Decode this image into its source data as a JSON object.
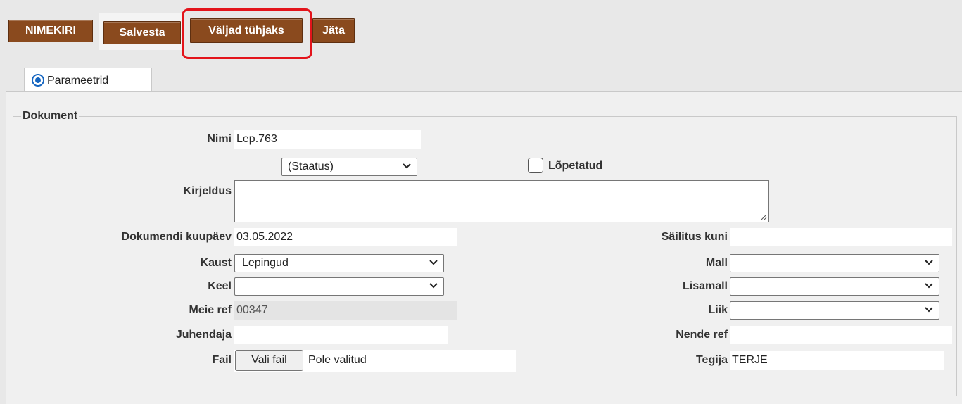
{
  "toolbar": {
    "nimekiri": "NIMEKIRI",
    "salvesta": "Salvesta",
    "valjad_tuhjaks": "Väljad tühjaks",
    "jata": "Jäta"
  },
  "tabs": [
    {
      "label": "Parameetrid",
      "selected": true
    }
  ],
  "section": {
    "legend": "Dokument"
  },
  "fields": {
    "nimi": {
      "label": "Nimi",
      "value": "Lep.763"
    },
    "staatus": {
      "value": "(Staatus)"
    },
    "lopetatud": {
      "label": "Lõpetatud",
      "checked": false
    },
    "kirjeldus": {
      "label": "Kirjeldus",
      "value": ""
    },
    "dokumendi_kuupaev": {
      "label": "Dokumendi kuupäev",
      "value": "03.05.2022"
    },
    "sailitus_kuni": {
      "label": "Säilitus kuni",
      "value": ""
    },
    "kaust": {
      "label": "Kaust",
      "value": "Lepingud"
    },
    "mall": {
      "label": "Mall",
      "value": ""
    },
    "keel": {
      "label": "Keel",
      "value": ""
    },
    "lisamall": {
      "label": "Lisamall",
      "value": ""
    },
    "meie_ref": {
      "label": "Meie ref",
      "value": "00347"
    },
    "liik": {
      "label": "Liik",
      "value": ""
    },
    "juhendaja": {
      "label": "Juhendaja",
      "value": ""
    },
    "nende_ref": {
      "label": "Nende ref",
      "value": ""
    },
    "fail": {
      "label": "Fail",
      "button": "Vali fail",
      "status": "Pole valitud"
    },
    "tegija": {
      "label": "Tegija",
      "value": "TERJE"
    }
  },
  "colors": {
    "button_bg": "#8a4a1e",
    "highlight": "#e3141b",
    "radio": "#1565c0"
  }
}
